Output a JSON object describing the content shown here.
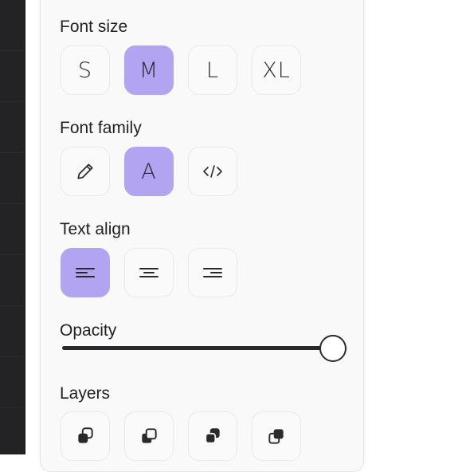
{
  "style_panel": {
    "font_size": {
      "label": "Font size",
      "options": [
        "S",
        "M",
        "L",
        "XL"
      ],
      "selected": "M"
    },
    "font_family": {
      "label": "Font family",
      "options": [
        "draw",
        "sans",
        "mono"
      ],
      "option_icons": [
        "pencil-icon",
        "sans-serif-icon",
        "code-icon"
      ],
      "option_glyph_sans": "A",
      "selected": "sans"
    },
    "text_align": {
      "label": "Text align",
      "options": [
        "start",
        "middle",
        "end"
      ],
      "option_icons": [
        "align-left-icon",
        "align-center-icon",
        "align-right-icon"
      ],
      "selected": "start"
    },
    "opacity": {
      "label": "Opacity",
      "value_percent": 100
    },
    "layers": {
      "label": "Layers",
      "option_icons": [
        "send-to-back-icon",
        "send-backward-icon",
        "bring-forward-icon",
        "bring-to-front-icon"
      ]
    }
  },
  "colors": {
    "accent": "#b3a4f1",
    "panel_bg": "#f9f9f9",
    "canvas_dark": "#232325",
    "icon": "#2a2a2e"
  }
}
